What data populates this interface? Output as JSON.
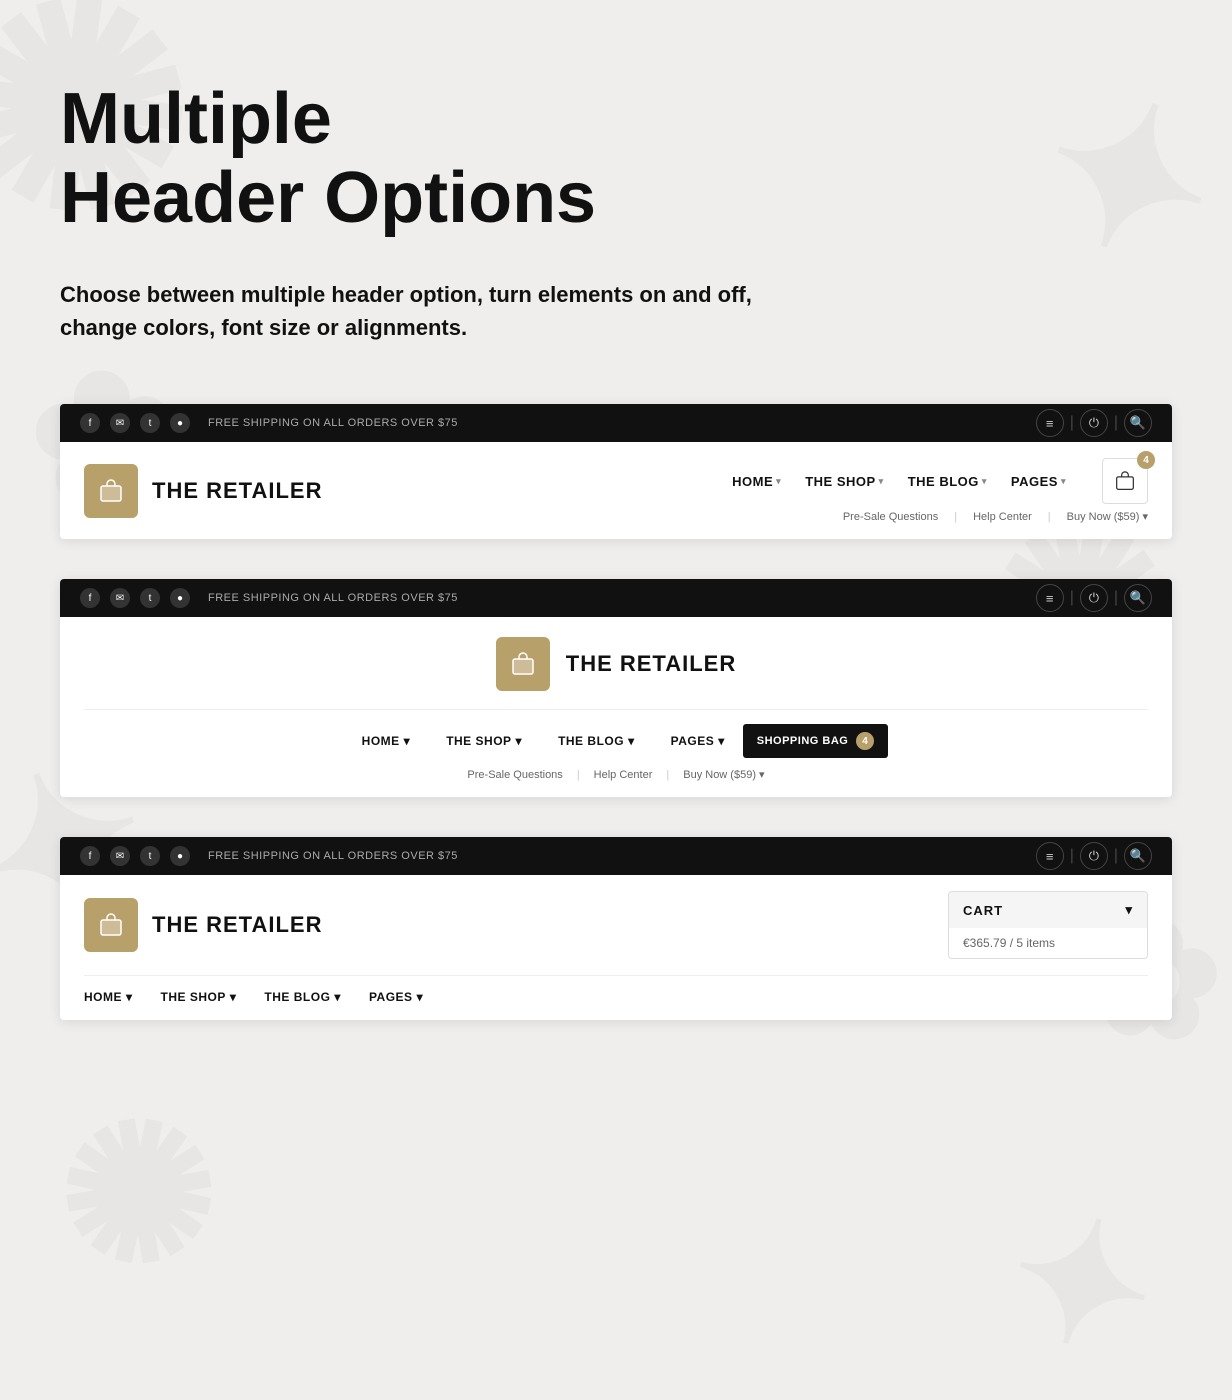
{
  "hero": {
    "title_line1": "Multiple",
    "title_line2": "Header Options",
    "description": "Choose between multiple header option, turn elements on and off, change colors, font size or alignments."
  },
  "topbar": {
    "shipping_text": "FREE SHIPPING ON ALL ORDERS OVER $75",
    "social_icons": [
      "f",
      "✉",
      "t",
      "●"
    ],
    "icons": [
      "≡",
      "⏻",
      "🔍"
    ]
  },
  "header1": {
    "logo_text": "THE RETAILER",
    "nav_items": [
      "HOME",
      "THE SHOP",
      "THE BLOG",
      "PAGES"
    ],
    "nav_secondary": [
      "Pre-Sale Questions",
      "Help Center",
      "Buy Now ($59)"
    ],
    "cart_badge": "4"
  },
  "header2": {
    "logo_text": "THE RETAILER",
    "nav_items": [
      "HOME",
      "THE SHOP",
      "THE BLOG",
      "PAGES"
    ],
    "nav_secondary": [
      "Pre-Sale Questions",
      "Help Center",
      "Buy Now ($59)"
    ],
    "shopping_bag_label": "SHOPPING BAG",
    "bag_badge": "4"
  },
  "header3": {
    "logo_text": "THE RETAILER",
    "nav_items": [
      "HOME",
      "THE SHOP",
      "THE BLOG",
      "PAGES"
    ],
    "cart_label": "CART",
    "cart_info": "€365.79 / 5 items"
  }
}
